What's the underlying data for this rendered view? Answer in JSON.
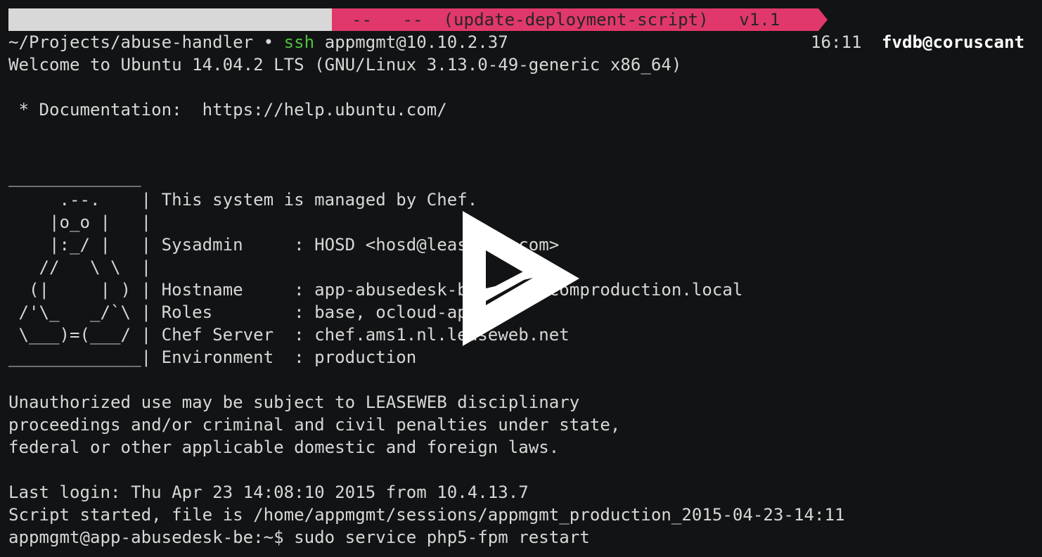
{
  "statusbar": {
    "left_segment": "",
    "right_segment": "--   --  (update-deployment-script)   v1.1"
  },
  "prompt_line": {
    "path": "~/Projects/abuse-handler • ",
    "command": "ssh",
    "args": " appmgmt@10.10.2.37",
    "time": "16:11",
    "user_host": "fvdb@coruscant"
  },
  "output_lines": [
    "Welcome to Ubuntu 14.04.2 LTS (GNU/Linux 3.13.0-49-generic x86_64)",
    "",
    " * Documentation:  https://help.ubuntu.com/",
    "",
    "",
    "_____________",
    "     .--.    | This system is managed by Chef.",
    "    |o_o |   |",
    "    |:_/ |   | Sysadmin     : HOSD <hosd@leaseweb.com>",
    "   //   \\ \\  |",
    "  (|     | ) | Hostname     : app-abusedesk-be.ams1.ocomproduction.local",
    " /'\\_   _/`\\ | Roles        : base, ocloud-app",
    " \\___)=(___/ | Chef Server  : chef.ams1.nl.leaseweb.net",
    "_____________| Environment  : production",
    "",
    "Unauthorized use may be subject to LEASEWEB disciplinary",
    "proceedings and/or criminal and civil penalties under state,",
    "federal or other applicable domestic and foreign laws.",
    "",
    "Last login: Thu Apr 23 14:08:10 2015 from 10.4.13.7",
    "Script started, file is /home/appmgmt/sessions/appmgmt_production_2015-04-23-14:11",
    "appmgmt@app-abusedesk-be:~$ sudo service php5-fpm restart"
  ],
  "overlay": {
    "icon": "play-icon"
  },
  "colors": {
    "background": "#121314",
    "foreground": "#d7d7d7",
    "status_pink": "#e0386a",
    "status_grey": "#d8d8d8",
    "ssh_green": "#4fc23c"
  }
}
